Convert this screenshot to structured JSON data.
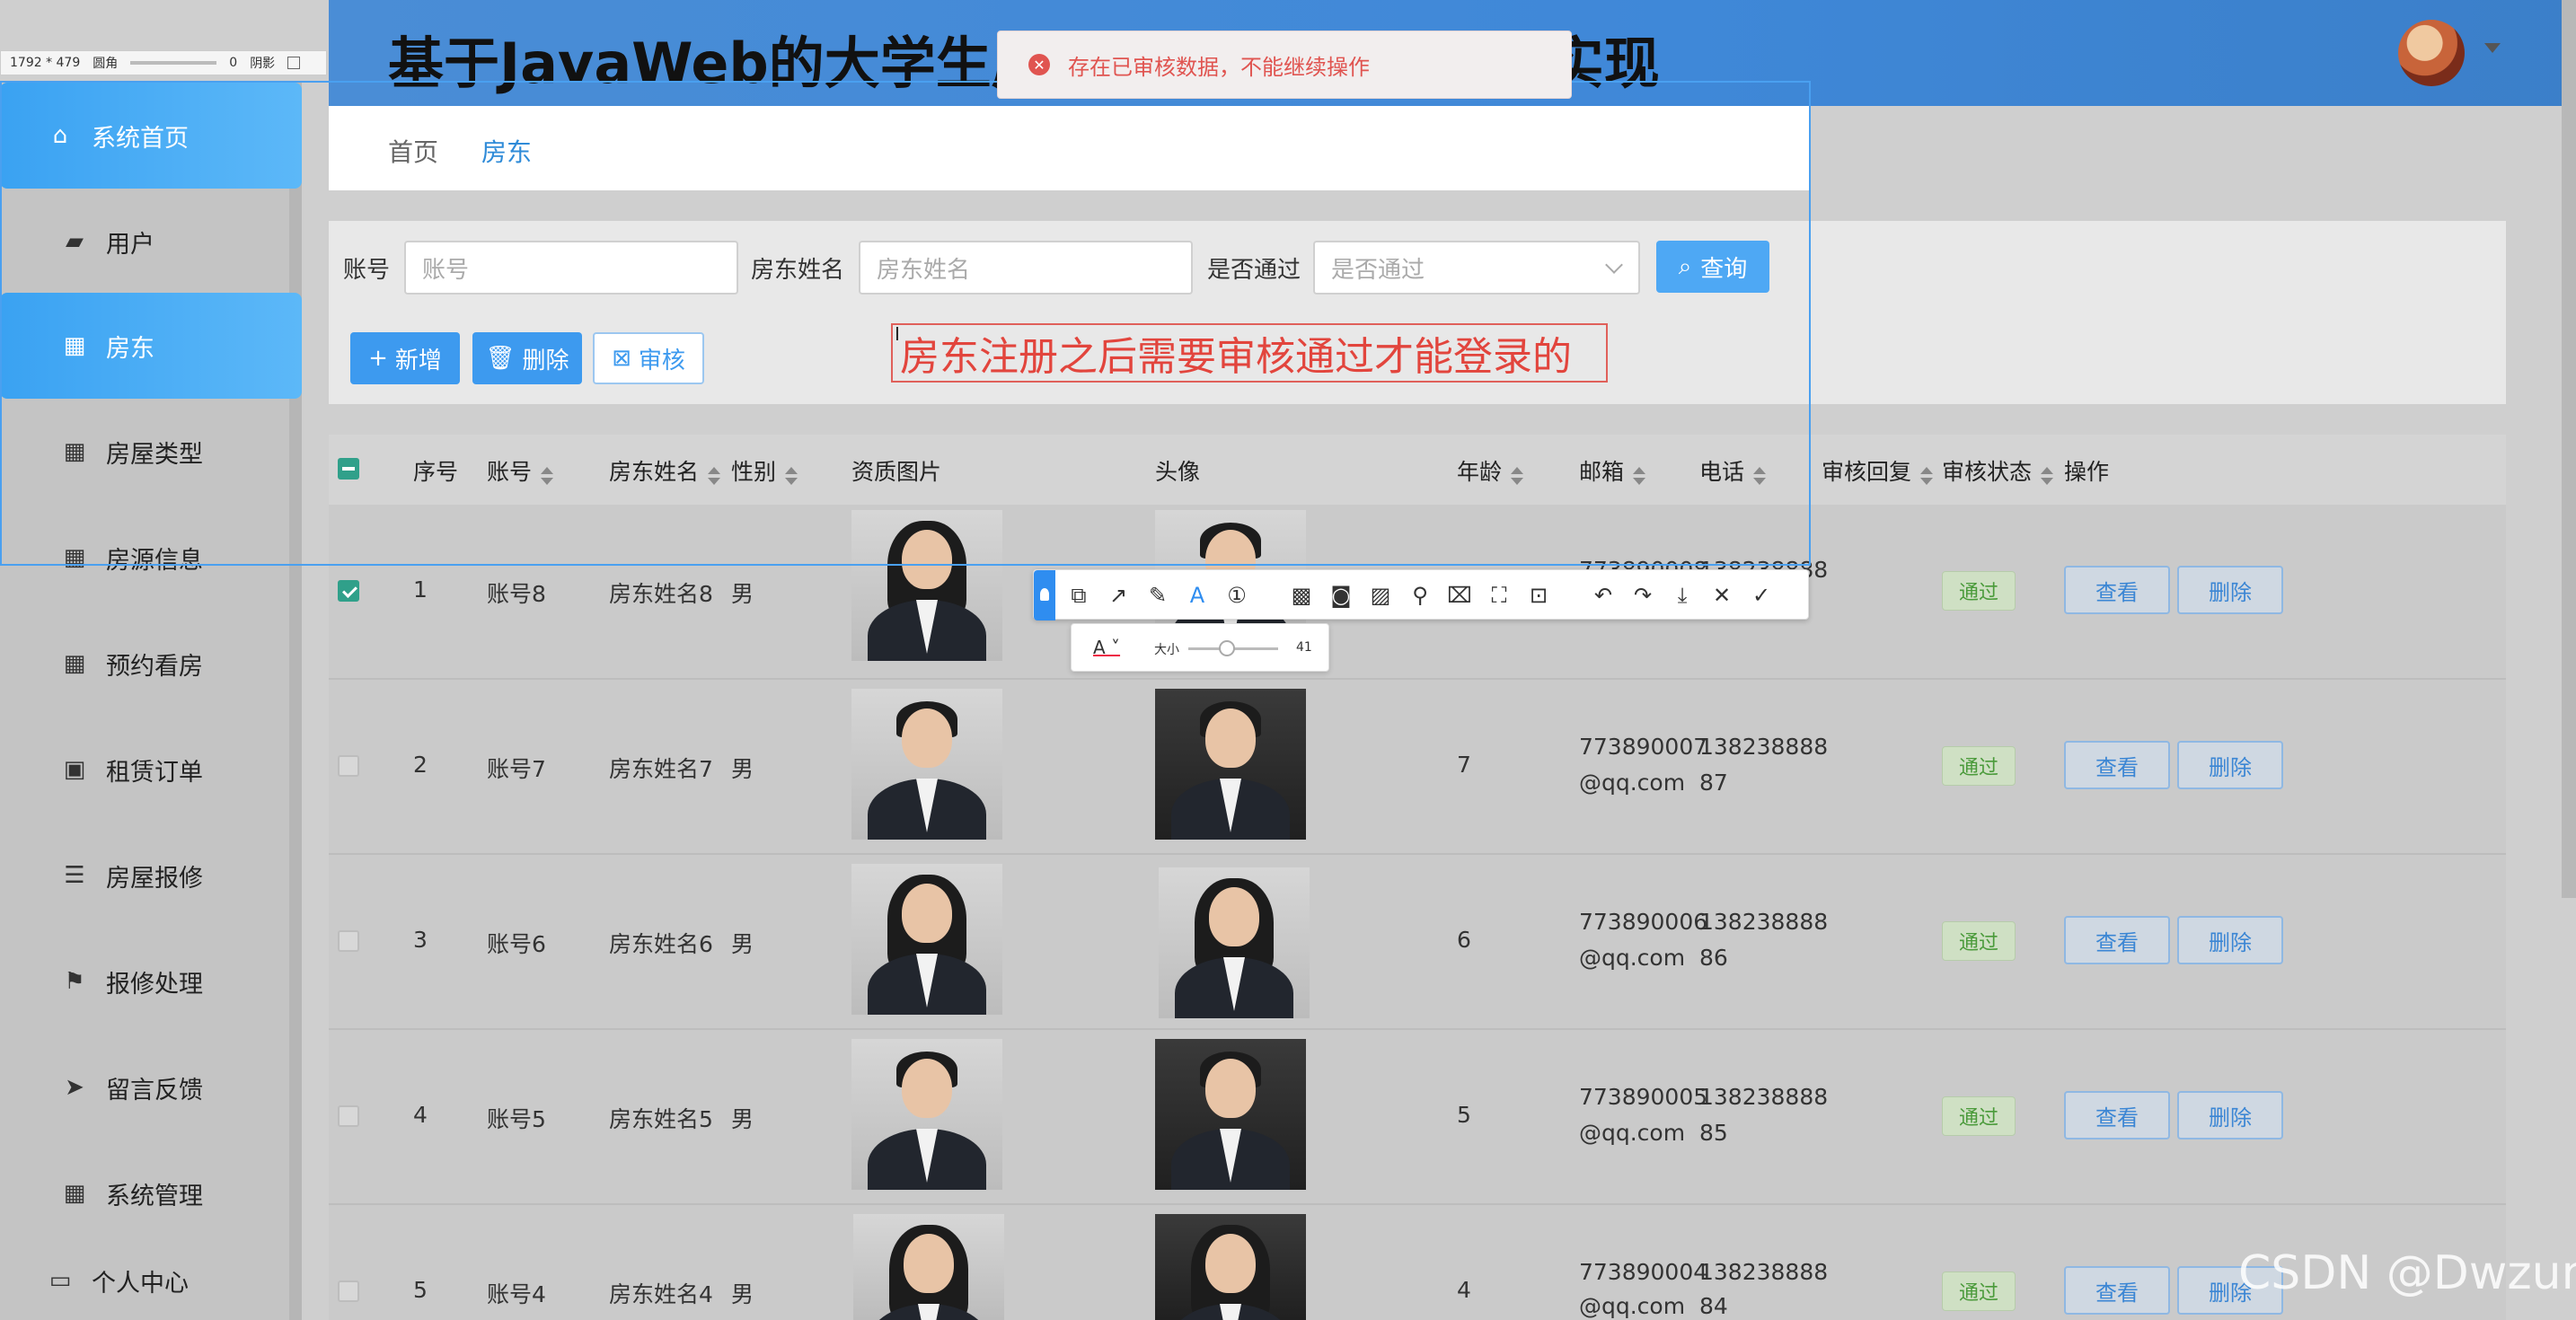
{
  "app": {
    "title": "基于JavaWeb的大学生房屋租赁系统的设计与实现"
  },
  "overlay": {
    "dimensions": "1792 * 479",
    "round_label": "圆角",
    "round_value": "0",
    "shadow_label": "阴影",
    "toast": "存在已审核数据，不能继续操作",
    "annotation": "房东注册之后需要审核通过才能登录的",
    "size_label": "大小",
    "size_value": "41",
    "watermark": "CSDN @Dwzun"
  },
  "sidebar": {
    "items": [
      {
        "label": "系统首页",
        "icon": "home-icon"
      },
      {
        "label": "用户",
        "icon": "user-icon"
      },
      {
        "label": "房东",
        "icon": "grid-icon"
      },
      {
        "label": "房屋类型",
        "icon": "grid-icon"
      },
      {
        "label": "房源信息",
        "icon": "grid-icon"
      },
      {
        "label": "预约看房",
        "icon": "grid-icon"
      },
      {
        "label": "租赁订单",
        "icon": "briefcase-icon"
      },
      {
        "label": "房屋报修",
        "icon": "list-icon"
      },
      {
        "label": "报修处理",
        "icon": "flag-icon"
      },
      {
        "label": "留言反馈",
        "icon": "send-icon"
      },
      {
        "label": "系统管理",
        "icon": "grid-icon"
      },
      {
        "label": "个人中心",
        "icon": "id-card-icon"
      }
    ]
  },
  "breadcrumb": {
    "home": "首页",
    "current": "房东"
  },
  "filters": {
    "account_label": "账号",
    "account_placeholder": "账号",
    "name_label": "房东姓名",
    "name_placeholder": "房东姓名",
    "approved_label": "是否通过",
    "approved_placeholder": "是否通过",
    "search_button": "查询"
  },
  "actions": {
    "add": "新增",
    "delete": "删除",
    "audit": "审核"
  },
  "table": {
    "columns": [
      "序号",
      "账号",
      "房东姓名",
      "性别",
      "资质图片",
      "头像",
      "年龄",
      "邮箱",
      "电话",
      "审核回复",
      "审核状态",
      "操作"
    ],
    "rows": [
      {
        "index": "1",
        "account": "账号8",
        "name": "房东姓名8",
        "gender": "男",
        "age": "",
        "email1": "773890008",
        "email2": "",
        "phone1": "138238888",
        "phone2": "",
        "status": "通过",
        "checked": true
      },
      {
        "index": "2",
        "account": "账号7",
        "name": "房东姓名7",
        "gender": "男",
        "age": "7",
        "email1": "773890007",
        "email2": "@qq.com",
        "phone1": "138238888",
        "phone2": "87",
        "status": "通过",
        "checked": false
      },
      {
        "index": "3",
        "account": "账号6",
        "name": "房东姓名6",
        "gender": "男",
        "age": "6",
        "email1": "773890006",
        "email2": "@qq.com",
        "phone1": "138238888",
        "phone2": "86",
        "status": "通过",
        "checked": false
      },
      {
        "index": "4",
        "account": "账号5",
        "name": "房东姓名5",
        "gender": "男",
        "age": "5",
        "email1": "773890005",
        "email2": "@qq.com",
        "phone1": "138238888",
        "phone2": "85",
        "status": "通过",
        "checked": false
      },
      {
        "index": "5",
        "account": "账号4",
        "name": "房东姓名4",
        "gender": "男",
        "age": "4",
        "email1": "773890004",
        "email2": "@qq.com",
        "phone1": "138238888",
        "phone2": "84",
        "status": "通过",
        "checked": false
      }
    ],
    "view_label": "查看",
    "delete_label": "删除"
  }
}
